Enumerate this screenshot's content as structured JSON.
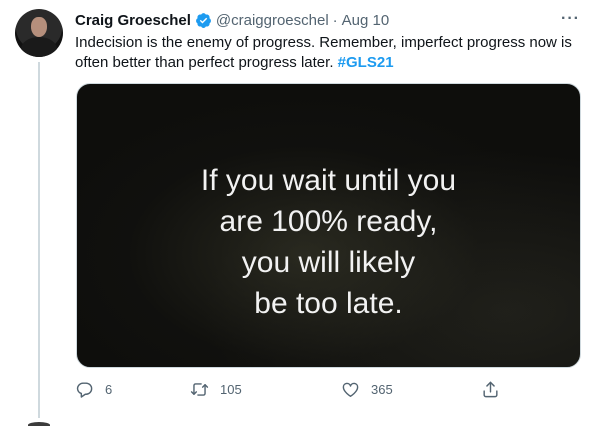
{
  "author": {
    "display_name": "Craig Groeschel",
    "handle": "@craiggroeschel",
    "separator": "·",
    "date": "Aug 10",
    "verified": true
  },
  "tweet": {
    "text": "Indecision is the enemy of progress. Remember, imperfect progress now is often better than perfect progress later.",
    "hashtag": "#GLS21",
    "more_label": "···"
  },
  "media": {
    "quote_lines": [
      "If you wait until you",
      "are 100% ready,",
      "you will likely",
      "be too late."
    ]
  },
  "actions": {
    "replies": "6",
    "retweets": "105",
    "likes": "365"
  },
  "colors": {
    "accent": "#1d9bf0",
    "muted": "#536471",
    "text": "#0f1419"
  },
  "icons": [
    "verified-badge-icon",
    "more-icon",
    "reply-icon",
    "retweet-icon",
    "like-icon",
    "share-icon"
  ]
}
